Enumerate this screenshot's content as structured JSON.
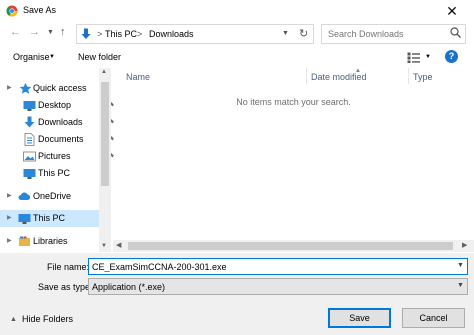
{
  "window": {
    "title": "Save As",
    "close_glyph": "✕"
  },
  "address_bar": {
    "separator": ">",
    "breadcrumbs": [
      "This PC",
      "Downloads"
    ],
    "refresh_glyph": "↻"
  },
  "search": {
    "placeholder": "Search Downloads"
  },
  "toolbar": {
    "organise_label": "Organise",
    "new_folder_label": "New folder",
    "help_label": "?"
  },
  "nav_pane": {
    "items": [
      {
        "label": "Quick access",
        "icon": "star-icon",
        "pinned": false
      },
      {
        "label": "Desktop",
        "icon": "desktop-icon",
        "pinned": true
      },
      {
        "label": "Downloads",
        "icon": "download-icon",
        "pinned": true
      },
      {
        "label": "Documents",
        "icon": "documents-icon",
        "pinned": true
      },
      {
        "label": "Pictures",
        "icon": "pictures-icon",
        "pinned": true
      },
      {
        "label": "This PC",
        "icon": "computer-icon",
        "pinned": false
      },
      {
        "label": "OneDrive",
        "icon": "cloud-icon",
        "pinned": false
      },
      {
        "label": "This PC",
        "icon": "computer-icon",
        "pinned": false,
        "selected": true
      },
      {
        "label": "Libraries",
        "icon": "library-icon",
        "pinned": false
      }
    ]
  },
  "file_list": {
    "columns": [
      "Name",
      "Date modified",
      "Type"
    ],
    "empty_message": "No items match your search."
  },
  "form": {
    "file_name_label": "File name:",
    "file_name_value": "CE_ExamSimCCNA-200-301.exe",
    "save_as_type_label": "Save as type:",
    "save_as_type_value": "Application (*.exe)"
  },
  "footer": {
    "hide_folders_label": "Hide Folders",
    "save_label": "Save",
    "cancel_label": "Cancel"
  },
  "colors": {
    "accent": "#0078d7",
    "selection": "#cce8ff",
    "form_bg": "#f0f0f0"
  }
}
